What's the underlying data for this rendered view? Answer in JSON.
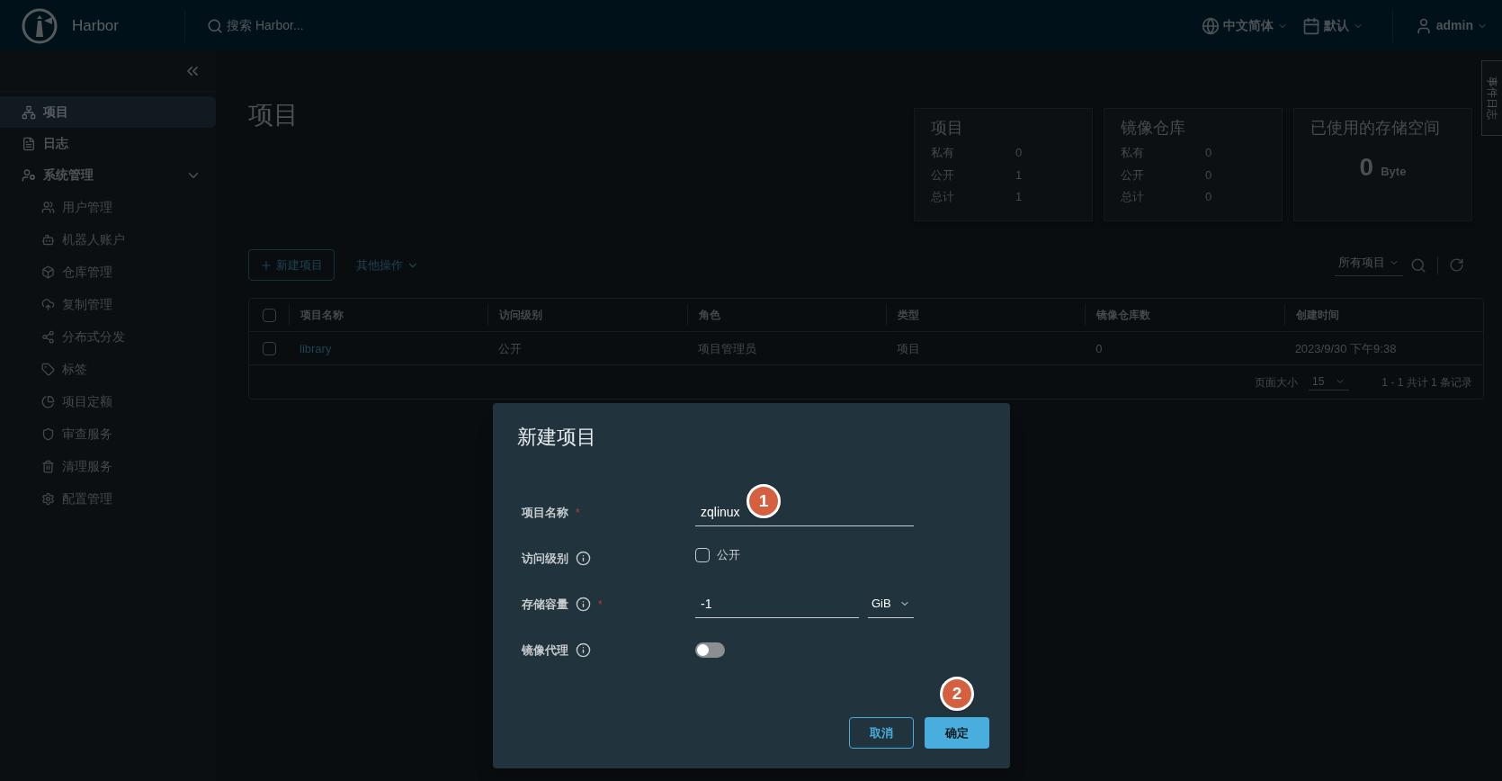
{
  "header": {
    "brand": "Harbor",
    "search": {
      "placeholder": "搜索 Harbor..."
    },
    "language": "中文简体",
    "theme": "默认",
    "user": "admin"
  },
  "sidebar": {
    "items": [
      {
        "label": "项目",
        "selected": true
      },
      {
        "label": "日志",
        "selected": false
      },
      {
        "label": "系统管理",
        "selected": false,
        "expanded": true,
        "children": [
          {
            "label": "用户管理",
            "selected": false
          },
          {
            "label": "机器人账户",
            "selected": false
          },
          {
            "label": "仓库管理",
            "selected": false
          },
          {
            "label": "复制管理",
            "selected": false
          },
          {
            "label": "分布式分发",
            "selected": false
          },
          {
            "label": "标签",
            "selected": false
          },
          {
            "label": "项目定额",
            "selected": false
          },
          {
            "label": "审查服务",
            "selected": false
          },
          {
            "label": "清理服务",
            "selected": false
          },
          {
            "label": "配置管理",
            "selected": false
          }
        ]
      }
    ]
  },
  "page": {
    "title": "项目",
    "stats": [
      {
        "kind": "counts",
        "title": "项目",
        "rows": [
          {
            "label": "私有",
            "value": "0"
          },
          {
            "label": "公开",
            "value": "1"
          },
          {
            "label": "总计",
            "value": "1"
          }
        ]
      },
      {
        "kind": "counts",
        "title": "镜像仓库",
        "rows": [
          {
            "label": "私有",
            "value": "0"
          },
          {
            "label": "公开",
            "value": "0"
          },
          {
            "label": "总计",
            "value": "0"
          }
        ]
      },
      {
        "kind": "storage",
        "title": "已使用的存储空间",
        "value": "0",
        "unit": "Byte"
      }
    ],
    "toolbar": {
      "new_button": "新建项目",
      "more_actions": "其他操作",
      "filter": "所有项目"
    },
    "table": {
      "select_all_checked": false,
      "columns": [
        "项目名称",
        "访问级别",
        "角色",
        "类型",
        "镜像仓库数",
        "创建时间"
      ],
      "rows": [
        {
          "checked": false,
          "cells": [
            "library",
            "公开",
            "项目管理员",
            "项目",
            "0",
            "2023/9/30 下午9:38"
          ]
        }
      ],
      "footer": {
        "page_size_label": "页面大小",
        "page_size": "15",
        "summary": "1 - 1 共计 1 条记录"
      }
    }
  },
  "side_tab": "事件日志",
  "dialog": {
    "title": "新建项目",
    "fields": [
      {
        "kind": "text",
        "label": "项目名称",
        "required_mark": "*",
        "info": false,
        "value": "zqlinux"
      },
      {
        "kind": "checkbox",
        "label": "访问级别",
        "info": true,
        "option": "公开",
        "checked": false
      },
      {
        "kind": "quota",
        "label": "存储容量",
        "required_mark": "*",
        "info": true,
        "value": "-1",
        "unit": "GiB"
      },
      {
        "kind": "toggle",
        "label": "镜像代理",
        "info": true,
        "on": false
      }
    ],
    "cancel": "取消",
    "confirm": "确定"
  },
  "annotations": [
    {
      "label": "1"
    },
    {
      "label": "2"
    }
  ]
}
